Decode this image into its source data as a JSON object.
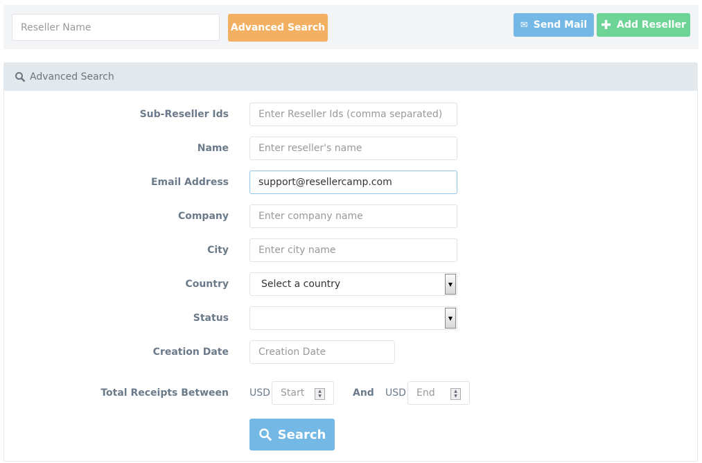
{
  "toolbar": {
    "search_placeholder": "Reseller Name",
    "advanced_search": "Advanced Search",
    "send_mail": "Send Mail",
    "add_reseller": "Add Reseller"
  },
  "panel": {
    "title": "Advanced Search"
  },
  "form": {
    "sub_ids": {
      "label": "Sub-Reseller Ids",
      "placeholder": "Enter Reseller Ids (comma separated)"
    },
    "name": {
      "label": "Name",
      "placeholder": "Enter reseller's name"
    },
    "email": {
      "label": "Email Address",
      "value": "support@resellercamp.com"
    },
    "company": {
      "label": "Company",
      "placeholder": "Enter company name"
    },
    "city": {
      "label": "City",
      "placeholder": "Enter city name"
    },
    "country": {
      "label": "Country",
      "value": "Select a country"
    },
    "status": {
      "label": "Status",
      "value": ""
    },
    "creation": {
      "label": "Creation Date",
      "placeholder": "Creation Date"
    },
    "receipts": {
      "label": "Total Receipts Between",
      "currency": "USD",
      "start_placeholder": "Start",
      "and": "And",
      "end_placeholder": "End"
    },
    "search_button": "Search"
  },
  "colors": {
    "advanced": "#f4b062",
    "send_mail": "#74b8e6",
    "add_reseller": "#6ed397",
    "search": "#74b8e6"
  }
}
